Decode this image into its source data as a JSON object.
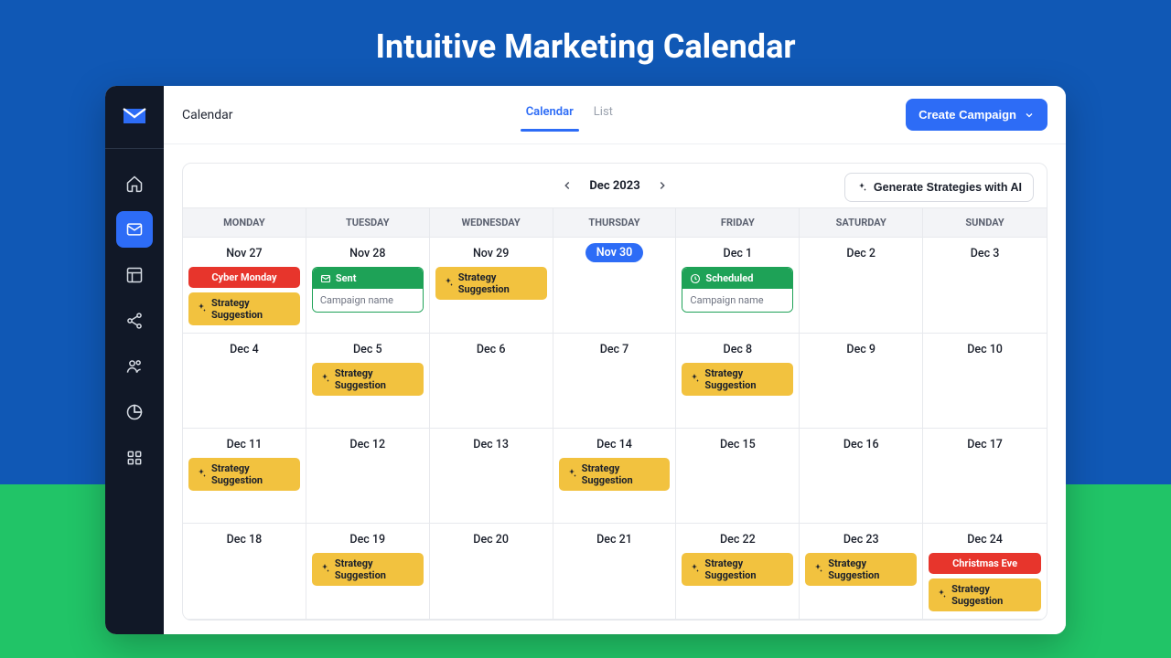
{
  "hero": {
    "title": "Intuitive Marketing Calendar"
  },
  "breadcrumb": "Calendar",
  "tabs": {
    "calendar": "Calendar",
    "list": "List"
  },
  "create_button": "Create Campaign",
  "month": "Dec 2023",
  "generate_ai": "Generate Strategies with AI",
  "dow": [
    "MONDAY",
    "TUESDAY",
    "WEDNESDAY",
    "THURSDAY",
    "FRIDAY",
    "SATURDAY",
    "SUNDAY"
  ],
  "labels": {
    "strategy": "Strategy Suggestion",
    "sent": "Sent",
    "scheduled": "Scheduled",
    "campaign_name": "Campaign name"
  },
  "weeks": [
    [
      {
        "date": "Nov 27",
        "items": [
          {
            "t": "red",
            "label": "Cyber Monday"
          },
          {
            "t": "strategy"
          }
        ]
      },
      {
        "date": "Nov 28",
        "items": [
          {
            "t": "sent"
          }
        ]
      },
      {
        "date": "Nov 29",
        "items": [
          {
            "t": "strategy"
          }
        ]
      },
      {
        "date": "Nov 30",
        "today": true,
        "items": []
      },
      {
        "date": "Dec 1",
        "items": [
          {
            "t": "scheduled"
          }
        ]
      },
      {
        "date": "Dec 2",
        "items": []
      },
      {
        "date": "Dec 3",
        "items": []
      }
    ],
    [
      {
        "date": "Dec 4",
        "items": []
      },
      {
        "date": "Dec 5",
        "items": [
          {
            "t": "strategy"
          }
        ]
      },
      {
        "date": "Dec 6",
        "items": []
      },
      {
        "date": "Dec 7",
        "items": []
      },
      {
        "date": "Dec 8",
        "items": [
          {
            "t": "strategy"
          }
        ]
      },
      {
        "date": "Dec 9",
        "items": []
      },
      {
        "date": "Dec 10",
        "items": []
      }
    ],
    [
      {
        "date": "Dec 11",
        "items": [
          {
            "t": "strategy"
          }
        ]
      },
      {
        "date": "Dec 12",
        "items": []
      },
      {
        "date": "Dec 13",
        "items": []
      },
      {
        "date": "Dec 14",
        "items": [
          {
            "t": "strategy"
          }
        ]
      },
      {
        "date": "Dec 15",
        "items": []
      },
      {
        "date": "Dec 16",
        "items": []
      },
      {
        "date": "Dec 17",
        "items": []
      }
    ],
    [
      {
        "date": "Dec 18",
        "items": []
      },
      {
        "date": "Dec 19",
        "items": [
          {
            "t": "strategy"
          }
        ]
      },
      {
        "date": "Dec 20",
        "items": []
      },
      {
        "date": "Dec 21",
        "items": []
      },
      {
        "date": "Dec 22",
        "items": [
          {
            "t": "strategy"
          }
        ]
      },
      {
        "date": "Dec 23",
        "items": [
          {
            "t": "strategy"
          }
        ]
      },
      {
        "date": "Dec 24",
        "items": [
          {
            "t": "red",
            "label": "Christmas Eve"
          },
          {
            "t": "strategy"
          }
        ]
      }
    ]
  ],
  "colors": {
    "primary": "#2d6cf6",
    "bg": "#1058b5",
    "green": "#1ea257",
    "yellow": "#f2c23f",
    "red": "#e7352c"
  }
}
